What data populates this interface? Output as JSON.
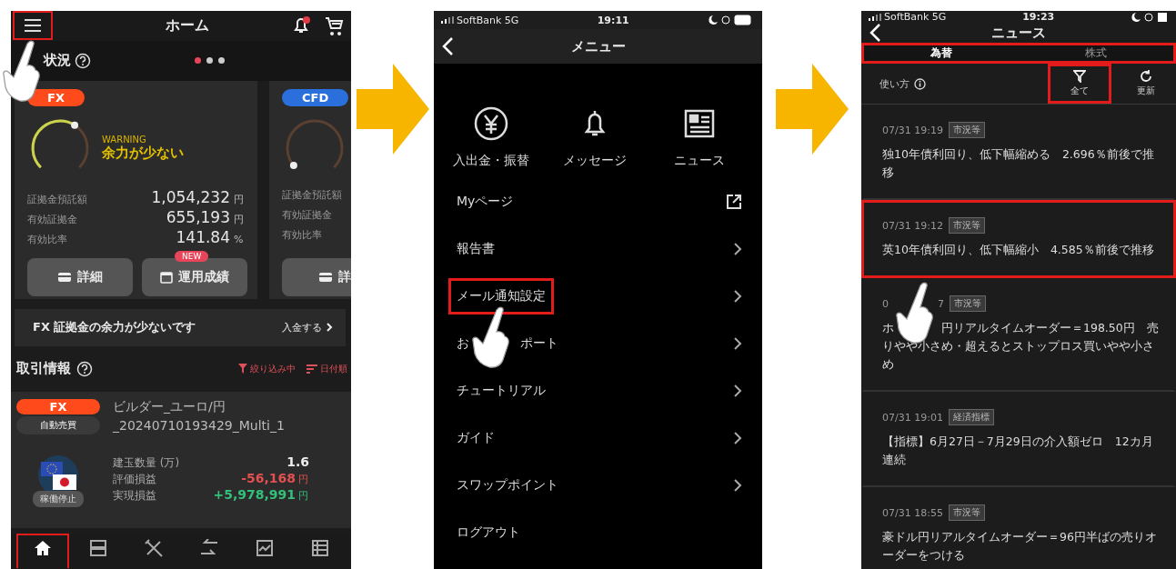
{
  "home": {
    "title": "ホーム",
    "menu_highlighted": true,
    "notification_dot": true,
    "section_title": "状況",
    "pages": [
      {
        "selected": true
      },
      {
        "selected": false
      },
      {
        "selected": false
      }
    ],
    "cards": [
      {
        "tag": "FX",
        "color": "#ff4a1c",
        "kind": "warning",
        "status_label": "WARNING",
        "status": "余力が少ない",
        "rows": [
          {
            "label": "証拠金預託額",
            "value": "1,054,232",
            "unit": "円"
          },
          {
            "label": "有効証拠金",
            "value": "655,193",
            "unit": "円"
          },
          {
            "label": "有効比率",
            "value": "141.84",
            "unit": "%"
          }
        ],
        "buttons": [
          {
            "kind": "detail",
            "label": "詳細"
          },
          {
            "kind": "calendar",
            "label": "運用成績",
            "badge": "NEW"
          }
        ]
      },
      {
        "tag": "CFD",
        "color": "#2a6fdb",
        "kind": "safe",
        "rows": [
          {
            "label": "証拠金預託額"
          },
          {
            "label": "有効証拠金"
          },
          {
            "label": "有効比率"
          }
        ],
        "buttons": [
          {
            "kind": "detail",
            "label": "詳"
          }
        ]
      }
    ],
    "banner": {
      "text": "FX 証拠金の余力が少ないです",
      "action": "入金する"
    },
    "trades": {
      "title": "取引情報",
      "filter": "絞り込み中",
      "sort": "日付順",
      "items": [
        {
          "tag": "FX",
          "mode": "自動売買",
          "name": "ビルダー_ユーロ/円",
          "id": "_20240710193429_Multi_1",
          "status": "稼働停止",
          "rows": [
            {
              "label": "建玉数量 (万)",
              "value": "1.6",
              "unit": "",
              "color": "#eeeeee"
            },
            {
              "label": "評価損益",
              "value": "-56,168",
              "unit": "円",
              "color": "#e2504f"
            },
            {
              "label": "実現損益",
              "value": "+5,978,991",
              "unit": "円",
              "color": "#33c07a"
            }
          ]
        }
      ]
    },
    "nav": [
      {
        "kind": "home",
        "selected": true,
        "highlighted": true
      },
      {
        "kind": "select",
        "selected": false,
        "highlighted": false
      },
      {
        "kind": "builder",
        "selected": false,
        "highlighted": false
      },
      {
        "kind": "trade",
        "selected": false,
        "highlighted": false
      },
      {
        "kind": "chart",
        "selected": false,
        "highlighted": false
      },
      {
        "kind": "list",
        "selected": false,
        "highlighted": false
      }
    ]
  },
  "menu": {
    "status": {
      "carrier": "SoftBank",
      "network": "5G",
      "time": "19:11"
    },
    "title": "メニュー",
    "shortcuts": [
      {
        "kind": "yen",
        "label": "入出金・振替"
      },
      {
        "kind": "bell",
        "label": "メッセージ"
      },
      {
        "kind": "news",
        "label": "ニュース"
      }
    ],
    "items": [
      {
        "label_parts": [
          "Myページ"
        ],
        "kind": "external",
        "highlighted": false
      },
      {
        "label_parts": [
          "報告書"
        ],
        "kind": "chevron",
        "highlighted": false
      },
      {
        "label_parts": [
          "メール通知設定"
        ],
        "kind": "chevron",
        "highlighted": true
      },
      {
        "label_parts": [
          "お",
          "ポート"
        ],
        "kind": "chevron",
        "highlighted": false
      },
      {
        "label_parts": [
          "チュートリアル"
        ],
        "kind": "chevron",
        "highlighted": false
      },
      {
        "label_parts": [
          "ガイド"
        ],
        "kind": "chevron",
        "highlighted": false
      },
      {
        "label_parts": [
          "スワップポイント"
        ],
        "kind": "chevron",
        "highlighted": false
      },
      {
        "label_parts": [
          "ログアウト"
        ],
        "kind": "plain",
        "highlighted": false
      }
    ]
  },
  "news": {
    "status": {
      "carrier": "SoftBank",
      "network": "5G",
      "time": "19:23"
    },
    "title": "ニュース",
    "tabs": [
      {
        "label": "為替",
        "selected": true
      },
      {
        "label": "株式",
        "selected": false
      }
    ],
    "tabs_highlighted": true,
    "help": "使い方",
    "tools": [
      {
        "kind": "filter",
        "label": "全て",
        "highlighted": true
      },
      {
        "kind": "refresh",
        "label": "更新",
        "highlighted": false
      }
    ],
    "items": [
      {
        "time_parts": [
          "07/31 19:19"
        ],
        "tag": "市況等",
        "title_parts": [
          "独10年債利回り、低下幅縮める　2.696％前後で推移"
        ],
        "highlighted": false
      },
      {
        "time_parts": [
          "07/31 19:12"
        ],
        "tag": "市況等",
        "title_parts": [
          "英10年債利回り、低下幅縮小　4.585％前後で推移"
        ],
        "highlighted": true
      },
      {
        "time_parts": [
          "0",
          "7"
        ],
        "tag": "市況等",
        "title_parts": [
          "ホ",
          "円リアルタイムオーダー＝198.50円　売りやや小さめ・超えるとストップロス買いやや小さめ"
        ],
        "highlighted": false
      },
      {
        "time_parts": [
          "07/31 19:01"
        ],
        "tag": "経済指標",
        "title_parts": [
          "【指標】6月27日－7月29日の介入額ゼロ　12カ月連続"
        ],
        "highlighted": false
      },
      {
        "time_parts": [
          "07/31 18:55"
        ],
        "tag": "市況等",
        "title_parts": [
          "豪ドル円リアルタイムオーダー＝96円半ばの売りオーダーをつける"
        ],
        "highlighted": false
      }
    ]
  }
}
